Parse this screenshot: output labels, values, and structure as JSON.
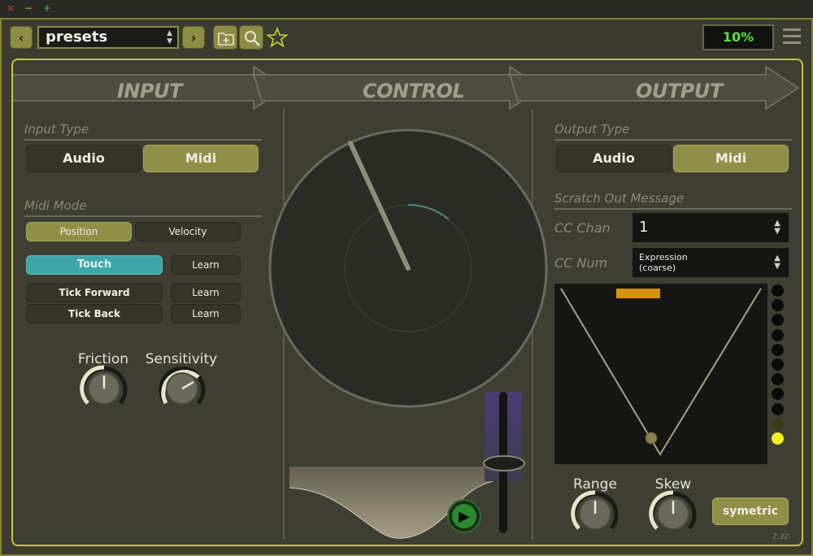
{
  "window": {
    "close_glyph": "×",
    "minimize_glyph": "−",
    "maximize_glyph": "+"
  },
  "toolbar": {
    "prev_glyph": "‹",
    "next_glyph": "›",
    "preset_name": "presets",
    "preset_arrows": "▲▼",
    "icons": [
      "folder-plus-icon",
      "search-icon",
      "star-icon",
      "menu-icon"
    ],
    "cpu_load": "10%"
  },
  "banner": {
    "input": "INPUT",
    "control": "CONTROL",
    "output": "OUTPUT"
  },
  "input": {
    "type_title": "Input Type",
    "type_options": [
      "Audio",
      "Midi"
    ],
    "type_selected": "Midi",
    "midi_mode_title": "Midi Mode",
    "mode_options": [
      "Position",
      "Velocity"
    ],
    "mode_selected": "Position",
    "touch_label": "Touch",
    "tick_forward_label": "Tick Forward",
    "tick_back_label": "Tick Back",
    "learn_label": "Learn",
    "friction_label": "Friction",
    "sensitivity_label": "Sensitivity",
    "friction_value": 0.5,
    "sensitivity_value": 0.7
  },
  "control": {
    "platter_angle_deg": -25,
    "slider_position": 0.35,
    "play_glyph": "▶"
  },
  "output": {
    "type_title": "Output Type",
    "type_options": [
      "Audio",
      "Midi"
    ],
    "type_selected": "Midi",
    "scratch_title": "Scratch Out Message",
    "cc_chan_label": "CC Chan",
    "cc_chan_value": "1",
    "cc_num_label": "CC Num",
    "cc_num_value_line1": "Expression",
    "cc_num_value_line2": "(coarse)",
    "select_arrows": "▲▼",
    "range_label": "Range",
    "skew_label": "Skew",
    "range_value": 0.5,
    "skew_value": 0.5,
    "symmetric_label": "symetric",
    "led_count": 11,
    "led_active_index": 10
  },
  "colors": {
    "accent": "#c7c73a",
    "olive_button": "#8f8f48",
    "teal_button": "#3fa6a8",
    "cpu_text": "#59e04e",
    "led_on": "#f2f01e",
    "marker": "#d4920f"
  },
  "footer": {
    "version": "7.32"
  }
}
